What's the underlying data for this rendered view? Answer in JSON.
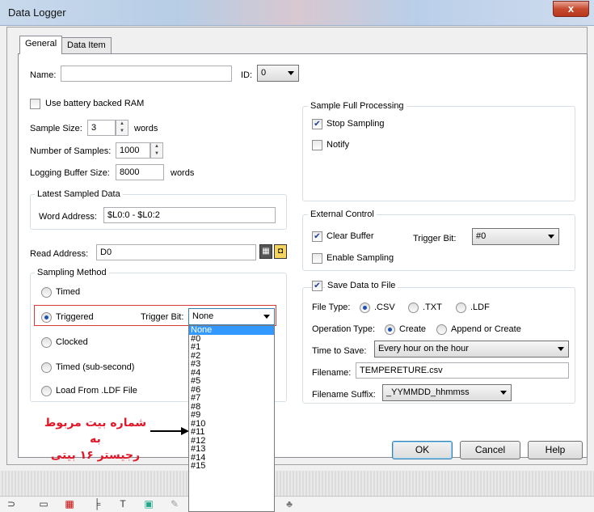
{
  "window": {
    "title": "Data Logger",
    "close_glyph": "x"
  },
  "tabs": [
    {
      "label": "General"
    },
    {
      "label": "Data Item"
    }
  ],
  "general": {
    "name_label": "Name:",
    "name_value": "",
    "id_label": "ID:",
    "id_value": "0",
    "battery_label": "Use battery backed RAM",
    "battery_checked": false,
    "sample_size_label": "Sample Size:",
    "sample_size_value": "3",
    "sample_size_unit": "words",
    "num_samples_label": "Number of Samples:",
    "num_samples_value": "1000",
    "buffer_label": "Logging Buffer Size:",
    "buffer_value": "8000",
    "buffer_unit": "words",
    "latest": {
      "title": "Latest Sampled Data",
      "word_address_label": "Word Address:",
      "word_address_value": "$L0:0 - $L0:2"
    },
    "read_address_label": "Read Address:",
    "read_address_value": "D0"
  },
  "sampling": {
    "title": "Sampling Method",
    "options": [
      {
        "label": "Timed",
        "selected": false
      },
      {
        "label": "Triggered",
        "selected": true
      },
      {
        "label": "Clocked",
        "selected": false
      },
      {
        "label": "Timed (sub-second)",
        "selected": false
      },
      {
        "label": "Load From .LDF File",
        "selected": false
      }
    ],
    "trigger_bit_label": "Trigger Bit:",
    "trigger_bit_value": "None",
    "dropdown_options": [
      "None",
      "#0",
      "#1",
      "#2",
      "#3",
      "#4",
      "#5",
      "#6",
      "#7",
      "#8",
      "#9",
      "#10",
      "#11",
      "#12",
      "#13",
      "#14",
      "#15"
    ]
  },
  "full_processing": {
    "title": "Sample Full Processing",
    "stop_label": "Stop Sampling",
    "stop_checked": true,
    "notify_label": "Notify",
    "notify_checked": false
  },
  "external": {
    "title": "External Control",
    "clear_label": "Clear Buffer",
    "clear_checked": true,
    "trigger_bit_label": "Trigger Bit:",
    "trigger_bit_value": "#0",
    "enable_label": "Enable Sampling",
    "enable_checked": false
  },
  "save": {
    "title": "Save Data to File",
    "checked": true,
    "file_type_label": "File Type:",
    "file_types": [
      {
        "label": ".CSV",
        "selected": true
      },
      {
        "label": ".TXT",
        "selected": false
      },
      {
        "label": ".LDF",
        "selected": false
      }
    ],
    "op_type_label": "Operation Type:",
    "op_types": [
      {
        "label": "Create",
        "selected": true
      },
      {
        "label": "Append or Create",
        "selected": false
      }
    ],
    "time_label": "Time to Save:",
    "time_value": "Every hour on the hour",
    "filename_label": "Filename:",
    "filename_value": "TEMPERETURE.csv",
    "suffix_label": "Filename Suffix:",
    "suffix_value": "_YYMMDD_hhmmss"
  },
  "buttons": {
    "ok": "OK",
    "cancel": "Cancel",
    "help": "Help"
  },
  "annotation": {
    "line1": "شماره بیت مربوط به",
    "line2": "رجیستر ۱۶ بیتی",
    "color": "#e0182a"
  }
}
